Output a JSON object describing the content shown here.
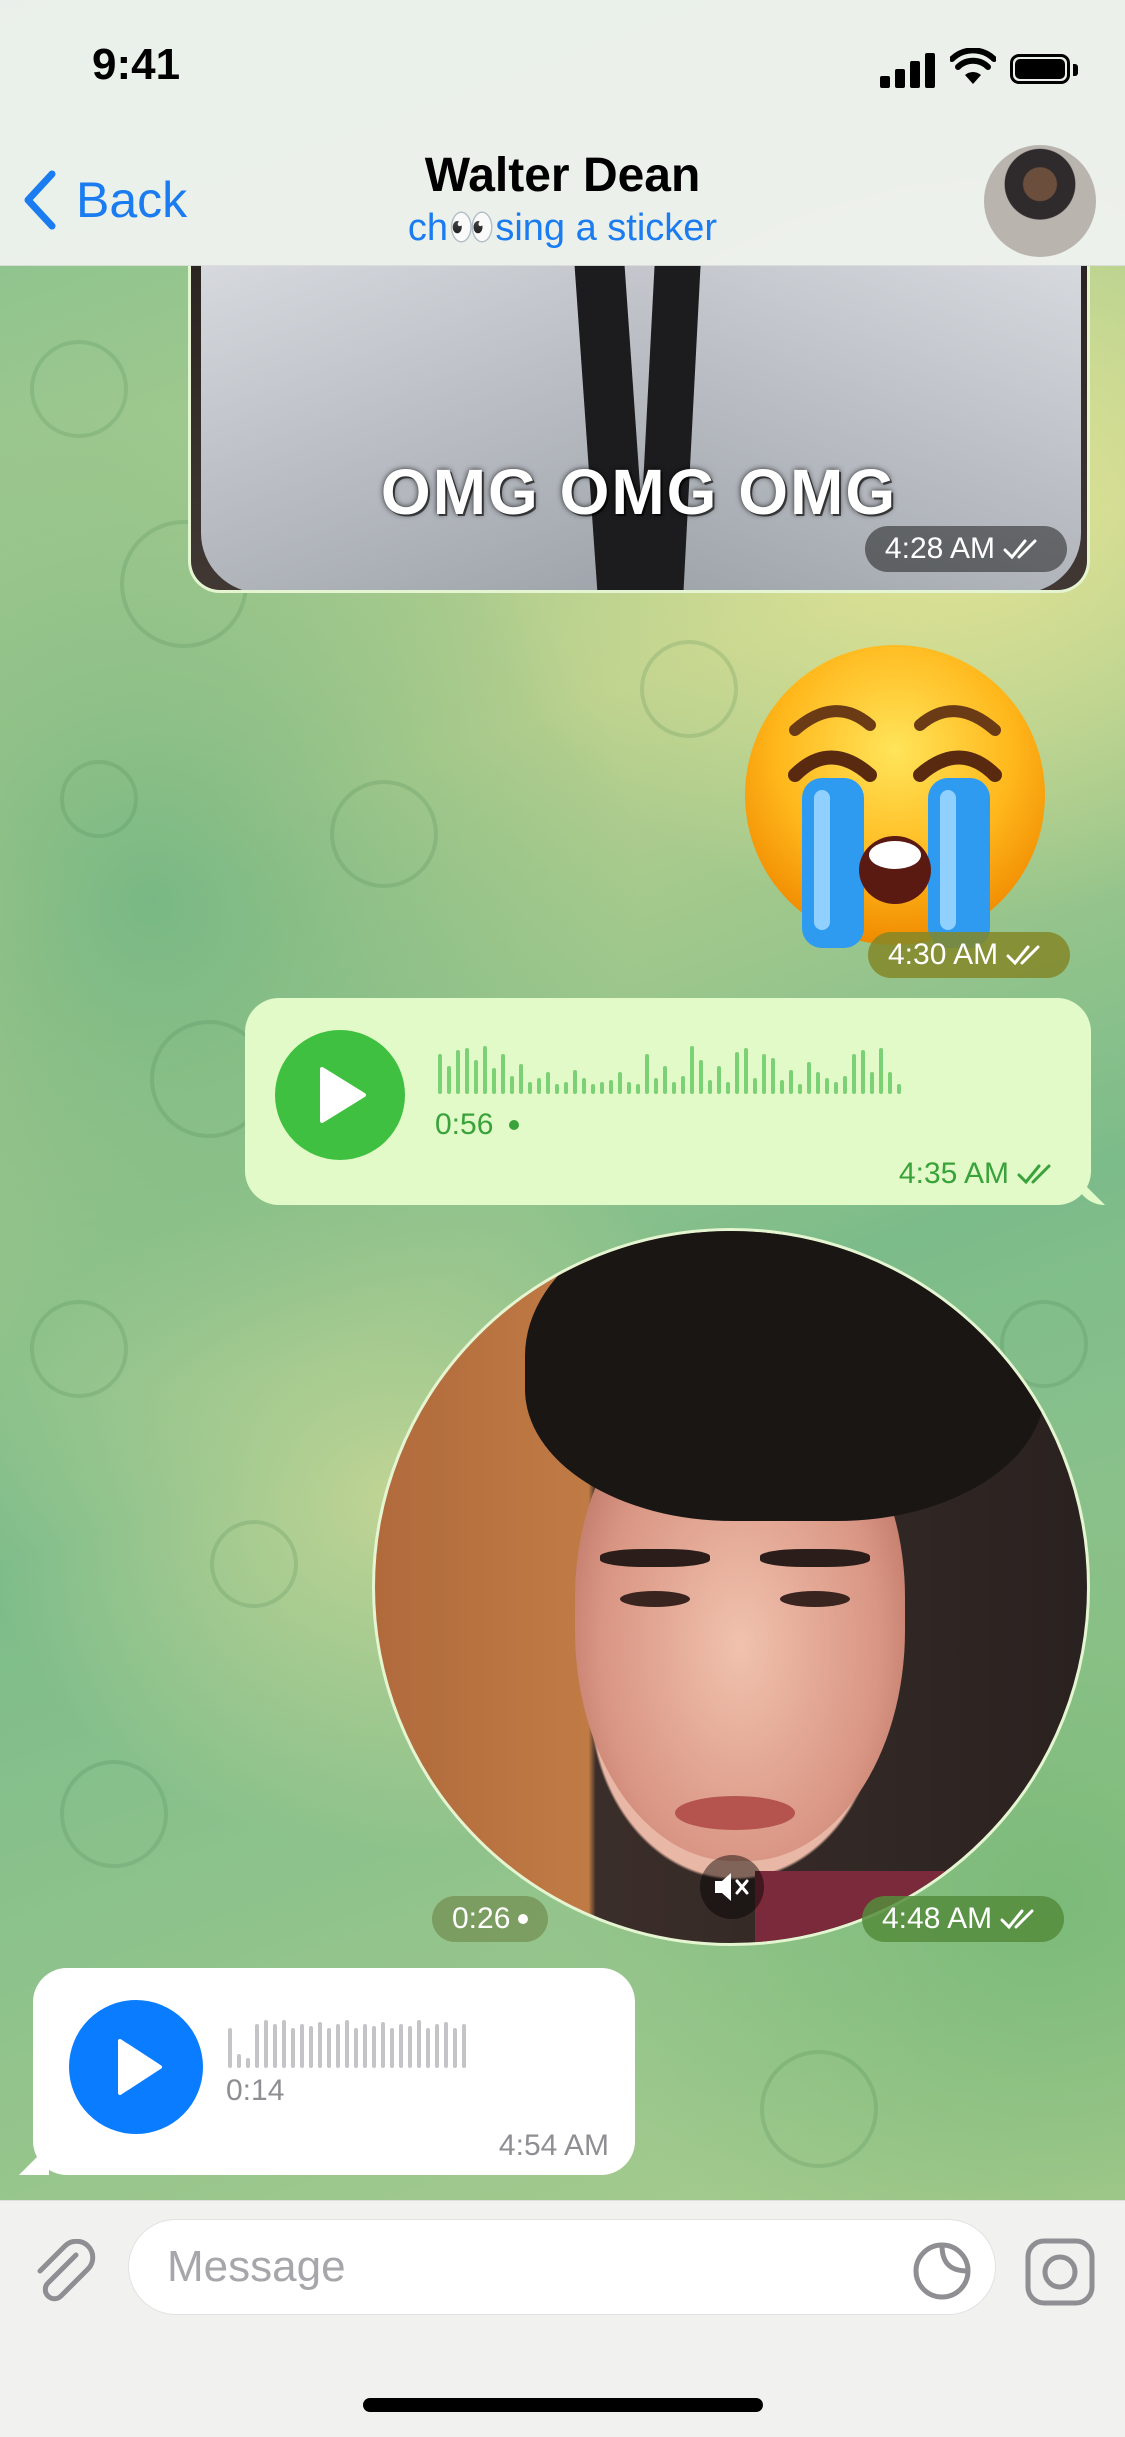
{
  "status_bar": {
    "time": "9:41"
  },
  "header": {
    "back_label": "Back",
    "title": "Walter Dean",
    "subtitle": "ch👀sing a sticker"
  },
  "messages": [
    {
      "type": "gif",
      "caption": "OMG OMG OMG",
      "time": "4:28 AM",
      "read": true
    },
    {
      "type": "sticker",
      "emoji": "😭",
      "time": "4:30 AM",
      "read": true
    },
    {
      "type": "voice",
      "direction": "outgoing",
      "duration": "0:56",
      "time": "4:35 AM",
      "read": true
    },
    {
      "type": "round_video",
      "duration": "0:26",
      "time": "4:48 AM",
      "read": true
    },
    {
      "type": "voice",
      "direction": "incoming",
      "duration": "0:14",
      "time": "4:54 AM"
    }
  ],
  "composer": {
    "placeholder": "Message"
  },
  "colors": {
    "accent": "#1a7cf0",
    "outgoing_bubble": "#e1fac8",
    "outgoing_text": "#3aa23a",
    "play_green": "#40c041",
    "play_blue": "#0a7cff"
  },
  "icons": [
    "back-chevron-icon",
    "signal-icon",
    "wifi-icon",
    "battery-icon",
    "play-icon",
    "double-check-icon",
    "mute-icon",
    "attach-icon",
    "sticker-icon",
    "camera-icon"
  ]
}
